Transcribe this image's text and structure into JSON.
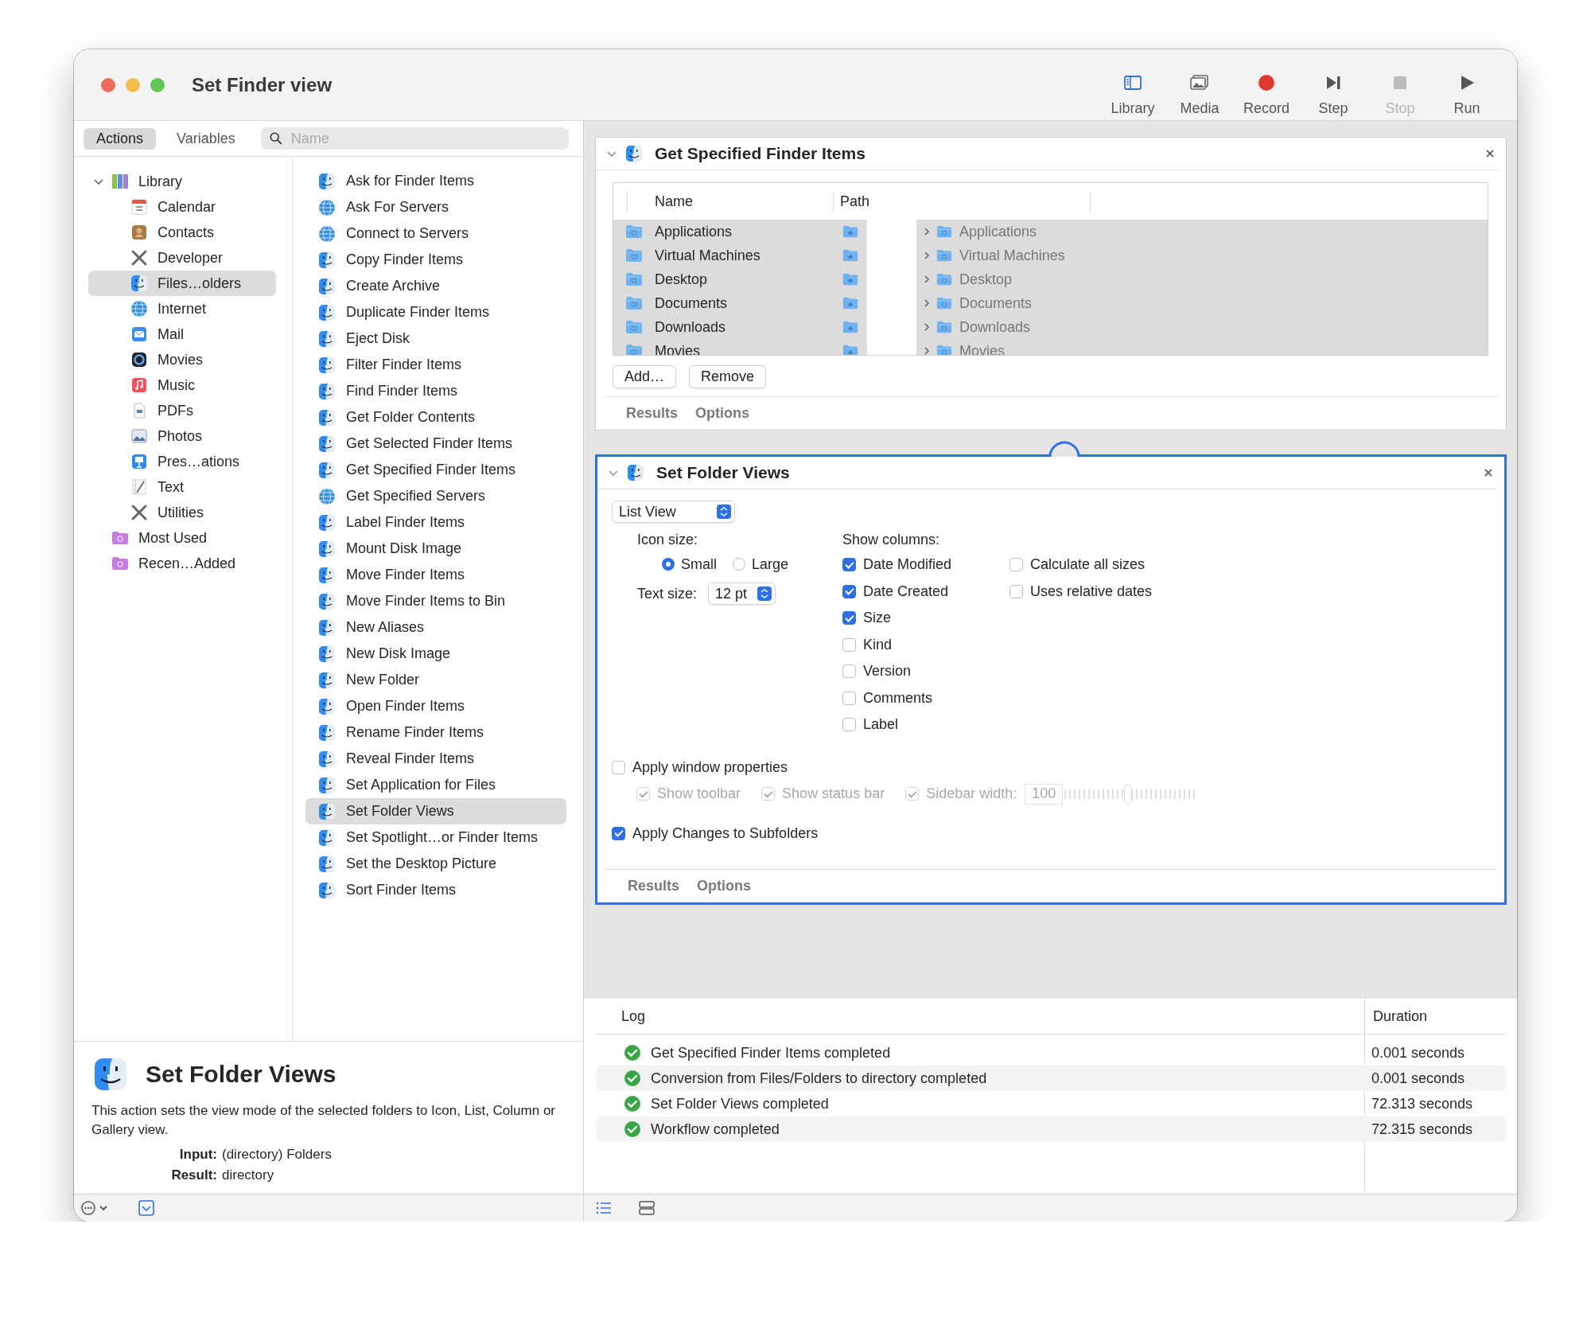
{
  "window": {
    "title": "Set Finder view"
  },
  "toolbar": [
    {
      "kind": "library",
      "label": "Library",
      "disabled": false
    },
    {
      "kind": "media",
      "label": "Media",
      "disabled": false
    },
    {
      "kind": "record",
      "label": "Record",
      "disabled": false
    },
    {
      "kind": "step",
      "label": "Step",
      "disabled": false
    },
    {
      "kind": "stop",
      "label": "Stop",
      "disabled": true
    },
    {
      "kind": "run",
      "label": "Run",
      "disabled": false
    }
  ],
  "tabs": [
    {
      "label": "Actions",
      "selected": true
    },
    {
      "label": "Variables",
      "selected": false
    }
  ],
  "search": {
    "placeholder": "Name"
  },
  "library": [
    {
      "label": "Library",
      "kind": "library",
      "selected": false,
      "expanded": true,
      "children": [
        {
          "label": "Calendar",
          "kind": "calendar",
          "selected": false
        },
        {
          "label": "Contacts",
          "kind": "contacts",
          "selected": false
        },
        {
          "label": "Developer",
          "kind": "tools",
          "selected": false
        },
        {
          "label": "Files…olders",
          "kind": "finder",
          "selected": true
        },
        {
          "label": "Internet",
          "kind": "globe",
          "selected": false
        },
        {
          "label": "Mail",
          "kind": "mail",
          "selected": false
        },
        {
          "label": "Movies",
          "kind": "video",
          "selected": false
        },
        {
          "label": "Music",
          "kind": "music",
          "selected": false
        },
        {
          "label": "PDFs",
          "kind": "document",
          "selected": false
        },
        {
          "label": "Photos",
          "kind": "photo",
          "selected": false
        },
        {
          "label": "Pres…ations",
          "kind": "presentation",
          "selected": false
        },
        {
          "label": "Text",
          "kind": "notepad",
          "selected": false
        },
        {
          "label": "Utilities",
          "kind": "tools",
          "selected": false
        }
      ]
    },
    {
      "label": "Most Used",
      "kind": "smart-folder",
      "selected": false
    },
    {
      "label": "Recen…Added",
      "kind": "smart-folder",
      "selected": false
    }
  ],
  "actions": [
    {
      "label": "Ask for Finder Items",
      "kind": "finder",
      "selected": false
    },
    {
      "label": "Ask For Servers",
      "kind": "globe",
      "selected": false
    },
    {
      "label": "Connect to Servers",
      "kind": "globe",
      "selected": false
    },
    {
      "label": "Copy Finder Items",
      "kind": "finder",
      "selected": false
    },
    {
      "label": "Create Archive",
      "kind": "finder",
      "selected": false
    },
    {
      "label": "Duplicate Finder Items",
      "kind": "finder",
      "selected": false
    },
    {
      "label": "Eject Disk",
      "kind": "finder",
      "selected": false
    },
    {
      "label": "Filter Finder Items",
      "kind": "finder",
      "selected": false
    },
    {
      "label": "Find Finder Items",
      "kind": "finder",
      "selected": false
    },
    {
      "label": "Get Folder Contents",
      "kind": "finder",
      "selected": false
    },
    {
      "label": "Get Selected Finder Items",
      "kind": "finder",
      "selected": false
    },
    {
      "label": "Get Specified Finder Items",
      "kind": "finder",
      "selected": false
    },
    {
      "label": "Get Specified Servers",
      "kind": "globe",
      "selected": false
    },
    {
      "label": "Label Finder Items",
      "kind": "finder",
      "selected": false
    },
    {
      "label": "Mount Disk Image",
      "kind": "finder",
      "selected": false
    },
    {
      "label": "Move Finder Items",
      "kind": "finder",
      "selected": false
    },
    {
      "label": "Move Finder Items to Bin",
      "kind": "finder",
      "selected": false
    },
    {
      "label": "New Aliases",
      "kind": "finder",
      "selected": false
    },
    {
      "label": "New Disk Image",
      "kind": "finder",
      "selected": false
    },
    {
      "label": "New Folder",
      "kind": "finder",
      "selected": false
    },
    {
      "label": "Open Finder Items",
      "kind": "finder",
      "selected": false
    },
    {
      "label": "Rename Finder Items",
      "kind": "finder",
      "selected": false
    },
    {
      "label": "Reveal Finder Items",
      "kind": "finder",
      "selected": false
    },
    {
      "label": "Set Application for Files",
      "kind": "finder",
      "selected": false
    },
    {
      "label": "Set Folder Views",
      "kind": "finder",
      "selected": true
    },
    {
      "label": "Set Spotlight…or Finder Items",
      "kind": "finder",
      "selected": false
    },
    {
      "label": "Set the Desktop Picture",
      "kind": "finder",
      "selected": false
    },
    {
      "label": "Sort Finder Items",
      "kind": "finder",
      "selected": false
    }
  ],
  "workflow": [
    {
      "kind": "items",
      "title": "Get Specified Finder Items",
      "selected": false,
      "expanded": true,
      "columns": [
        "Name",
        "Path"
      ],
      "rows": [
        {
          "name": "Applications",
          "path": "Applications"
        },
        {
          "name": "Virtual Machines",
          "path": "Virtual Machines"
        },
        {
          "name": "Desktop",
          "path": "Desktop"
        },
        {
          "name": "Documents",
          "path": "Documents"
        },
        {
          "name": "Downloads",
          "path": "Downloads"
        },
        {
          "name": "Movies",
          "path": "Movies"
        }
      ],
      "buttons": [
        "Add…",
        "Remove"
      ],
      "tabs": [
        "Results",
        "Options"
      ]
    },
    {
      "kind": "folder-views",
      "title": "Set Folder Views",
      "selected": true,
      "expanded": true,
      "view": "List View",
      "icon_size": {
        "label": "Icon size:",
        "options": [
          {
            "label": "Small",
            "selected": true
          },
          {
            "label": "Large",
            "selected": false
          }
        ]
      },
      "text_size": {
        "label": "Text size:",
        "value": "12 pt"
      },
      "show_columns": {
        "label": "Show columns:",
        "items": [
          {
            "label": "Date Modified",
            "checked": true
          },
          {
            "label": "Date Created",
            "checked": true
          },
          {
            "label": "Size",
            "checked": true
          },
          {
            "label": "Kind",
            "checked": false
          },
          {
            "label": "Version",
            "checked": false
          },
          {
            "label": "Comments",
            "checked": false
          },
          {
            "label": "Label",
            "checked": false
          }
        ]
      },
      "options": [
        {
          "label": "Calculate all sizes",
          "checked": false
        },
        {
          "label": "Uses relative dates",
          "checked": false
        }
      ],
      "window_properties": {
        "label": "Apply window properties",
        "checked": false,
        "items": [
          {
            "label": "Show toolbar",
            "checked": true,
            "disabled": true
          },
          {
            "label": "Show status bar",
            "checked": true,
            "disabled": true
          }
        ],
        "sidebar": {
          "label": "Sidebar width:",
          "checked": true,
          "disabled": true,
          "value": "100",
          "level": 0.48
        }
      },
      "subfolders": {
        "label": "Apply Changes to Subfolders",
        "checked": true
      },
      "tabs": [
        "Results",
        "Options"
      ]
    }
  ],
  "description": {
    "title": "Set Folder Views",
    "text": "This action sets the view mode of the selected folders to Icon, List, Column or Gallery view.",
    "input": {
      "label": "Input:",
      "value": "(directory) Folders"
    },
    "result": {
      "label": "Result:",
      "value": "directory"
    }
  },
  "log": {
    "columns": [
      "Log",
      "Duration"
    ],
    "rows": [
      {
        "message": "Get Specified Finder Items completed",
        "duration": "0.001 seconds",
        "success": true
      },
      {
        "message": "Conversion from Files/Folders to directory completed",
        "duration": "0.001 seconds",
        "success": true
      },
      {
        "message": "Set Folder Views completed",
        "duration": "72.313 seconds",
        "success": true
      },
      {
        "message": "Workflow completed",
        "duration": "72.315 seconds",
        "success": true
      }
    ]
  }
}
